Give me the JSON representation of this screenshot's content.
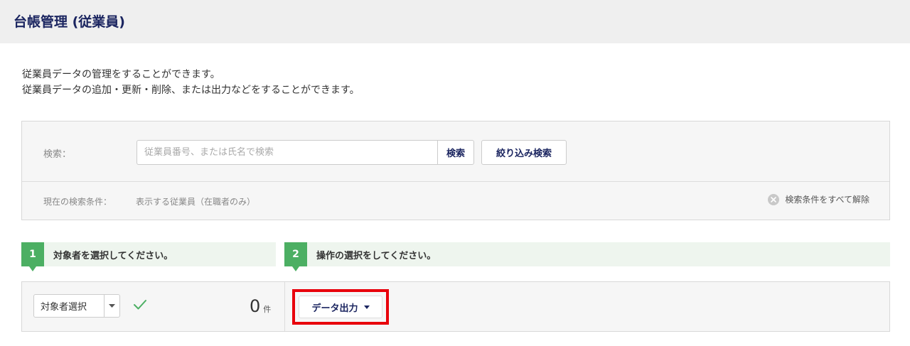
{
  "header": {
    "title": "台帳管理 (従業員)"
  },
  "description": {
    "line1": "従業員データの管理をすることができます。",
    "line2": "従業員データの追加・更新・削除、または出力などをすることができます。"
  },
  "search": {
    "label": "検索：",
    "placeholder": "従業員番号、または氏名で検索",
    "value": "",
    "search_button": "検索",
    "filter_button": "絞り込み検索",
    "current_conditions_label": "現在の検索条件：",
    "current_conditions_value": "表示する従業員（在職者のみ）",
    "clear_all": "検索条件をすべて解除"
  },
  "steps": [
    {
      "number": "1",
      "text": "対象者を選択してください。"
    },
    {
      "number": "2",
      "text": "操作の選択をしてください。"
    }
  ],
  "selection": {
    "select_label": "対象者選択",
    "count": "0",
    "count_unit": "件"
  },
  "actions": {
    "export_label": "データ出力"
  },
  "colors": {
    "brand_navy": "#1b2560",
    "step_green": "#4caf63",
    "highlight_red": "#e8000b"
  }
}
